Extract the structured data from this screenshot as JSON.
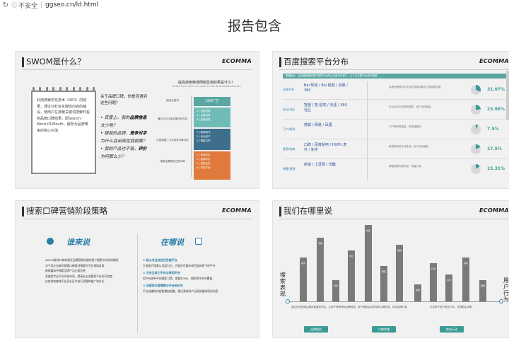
{
  "browser": {
    "reload_icon": "reload-icon",
    "insecure_label": "不安全",
    "url": "ggseo.cn/ld.html"
  },
  "page": {
    "title": "报告包含"
  },
  "slides": [
    {
      "title": "SWOM是什么？",
      "logo": "ECOMMA",
      "note_text": "利用搜索优化技术（SEO）的结果，通过对社会化媒体内容的铺设，使用户在搜索关键词搜索时看到品牌口碑结果，即Search-Word-Of-Mouth，服务为品牌带来的核心价值",
      "banner": "提高搜索精准网络营销效果是什么？"
    },
    {
      "title": "百度搜索平台分布",
      "logo": "ECOMMA",
      "rows": [
        {
          "label": "问答平台",
          "brands": "Bai 知道 / Bai 经验 / 百度 / 360",
          "pct": "31.07%"
        },
        {
          "label": "论坛/社区",
          "brands": "智部 / 智·贴吧 / 天涯 / 360社区",
          "pct": "23.86%"
        },
        {
          "label": "门户/新闻",
          "brands": "搜狐 / 网易 / 凤凰",
          "pct": "7.5%"
        },
        {
          "label": "垂直/电商",
          "brands": "口碑 / 百度贴吧 / HUPU 虎扑 / 知乎",
          "pct": "17.5%"
        },
        {
          "label": "博客/视频",
          "brands": "新浪 / 土豆网 / 优酷",
          "pct": "15.31%"
        }
      ]
    },
    {
      "title": "搜索口碑营销阶段策略",
      "logo": "ECOMMA",
      "left_heading": "谁来说",
      "right_heading": "在哪说",
      "left_lines": [
        "SWOM要求口碑内容在品牌营销关键的用户搜索节点持续铺设",
        "对于设计出来的搜索口碑素材需要在专业领域发表",
        "新闻媒体中搜索品牌产品正面信息",
        "多使用专业平台内容布局，提高在主流搜索平台的可信度",
        "在各类的媒体平台及社区中进行话题的推广和讨论"
      ],
      "right_points": [
        {
          "head": "① 核心关注点应在百度平台",
          "body": "主流用户搜索以百度为主，内容应尽量布局百度体系下的平台"
        },
        {
          "head": "② 次关注其它平台与常用平台",
          "body": "用户有多种不同搜索习惯，需要在360、搜狗等平台内覆盖"
        },
        {
          "head": "③ 自媒体内容需要与平台相补充",
          "body": "平台自媒体内容能增加权重，需注意持续产出高质量的原创内容"
        }
      ]
    },
    {
      "title": "我们在哪里说",
      "logo": "ECOMMA",
      "left_axis_label": "搜索表现",
      "right_axis_label": "用户行为",
      "buttons": [
        "品牌搜索",
        "口碑传播",
        "转化行动"
      ]
    }
  ]
}
